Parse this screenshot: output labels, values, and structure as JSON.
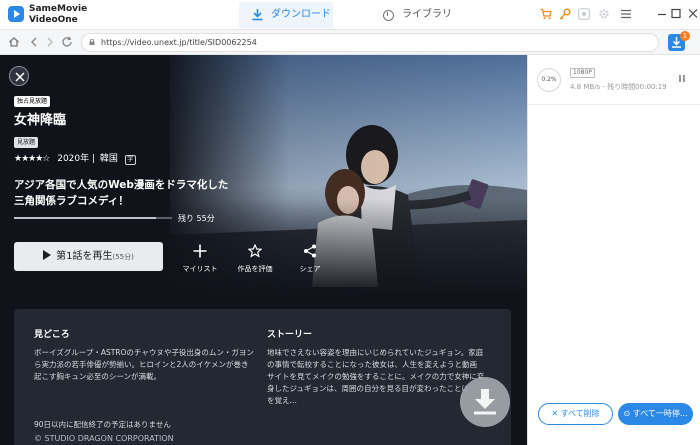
{
  "app": {
    "brand_line1": "SameMovie",
    "brand_line2": "VideoOne",
    "accent_color": "#2b88e6",
    "tabs": [
      {
        "label": "ダウンロード",
        "icon": "download-icon",
        "active": true
      },
      {
        "label": "ライブラリ",
        "icon": "clock-icon",
        "active": false
      }
    ],
    "toolbar_icons": [
      "cart-icon",
      "key-icon",
      "cloud-icon",
      "gear-icon",
      "menu-icon",
      "minimize-icon",
      "maximize-icon",
      "close-icon"
    ]
  },
  "address_bar": {
    "url": "https://video.unext.jp/title/SID0062254",
    "queue_badge": "1"
  },
  "title_page": {
    "exclusive_badge": "独占見放題",
    "title": "女神降臨",
    "free_badge": "見放題",
    "stars": "★★★★☆",
    "rating_value": 4,
    "year": "2020年",
    "separator": "|",
    "country": "韓国",
    "subtitle_badge": "字",
    "tagline_line1": "アジア各国で人気のWeb漫画をドラマ化した",
    "tagline_line2": "三角関係ラブコメディ！",
    "watch_progress": 0.9,
    "remaining": "残り 55分",
    "play_label": "第1話を再生",
    "play_sub": "(55分)",
    "actions": {
      "mylist": "マイリスト",
      "rate": "作品を評価",
      "share": "シェア"
    },
    "highlights_heading": "見どころ",
    "highlights_lines": [
      "ボーイズグループ・ASTROのチャウヌや子役出身のムン・ガヨン",
      "ら実力派の若手俳優が勢揃い。ヒロインと2人のイケメンが巻き",
      "起こす胸キュン必至のシーンが満載。"
    ],
    "story_heading": "ストーリー",
    "story_lines": [
      "地味でさえない容姿を理由にいじめられていたジュギョン。家庭",
      "の事情で転校することになった彼女は、人生を変えようと動画",
      "サイトを見てメイクの勉強をすることに。メイクの力で女神に変",
      "身したジュギョンは、周囲の自分を見る目が変わったことに",
      "を覚え…"
    ],
    "notice": "90日以内に配信終了の予定はありません",
    "copyright": "© STUDIO DRAGON CORPORATION"
  },
  "download_panel": {
    "task": {
      "progress": "0.2%",
      "quality": "1080P",
      "status": "4.8 MB/s - 残り時間00:00:19"
    },
    "delete_all": "すべて削除",
    "pause_all": "すべて一時停..."
  }
}
